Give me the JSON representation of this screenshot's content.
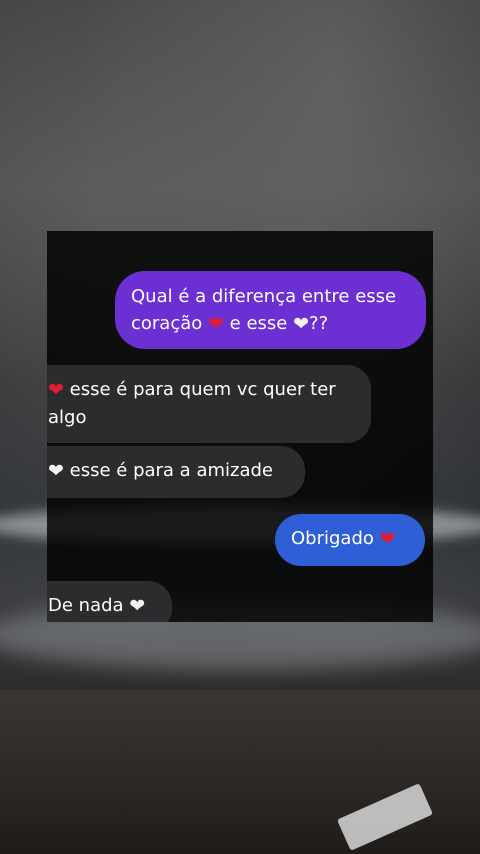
{
  "messages": [
    {
      "side": "sent",
      "color": "#6b2fd3",
      "line1": "Qual é a diferença entre esse",
      "line2_a": "coração",
      "heart1": "red",
      "line2_b": "e esse",
      "heart2": "white",
      "line2_c": "??"
    },
    {
      "side": "received",
      "heart": "red",
      "line1": "esse é para quem vc quer ter",
      "line2": "algo"
    },
    {
      "side": "received",
      "heart": "white",
      "text": "esse é para a amizade"
    },
    {
      "side": "sent",
      "color": "#2f5fd6",
      "text": "Obrigado",
      "heart": "red"
    },
    {
      "side": "received",
      "text": "De nada",
      "heart": "white"
    }
  ],
  "icons": {
    "red_heart": "red-heart-emoji",
    "white_heart": "white-heart-emoji"
  },
  "glyphs": {
    "heart": "❤"
  }
}
